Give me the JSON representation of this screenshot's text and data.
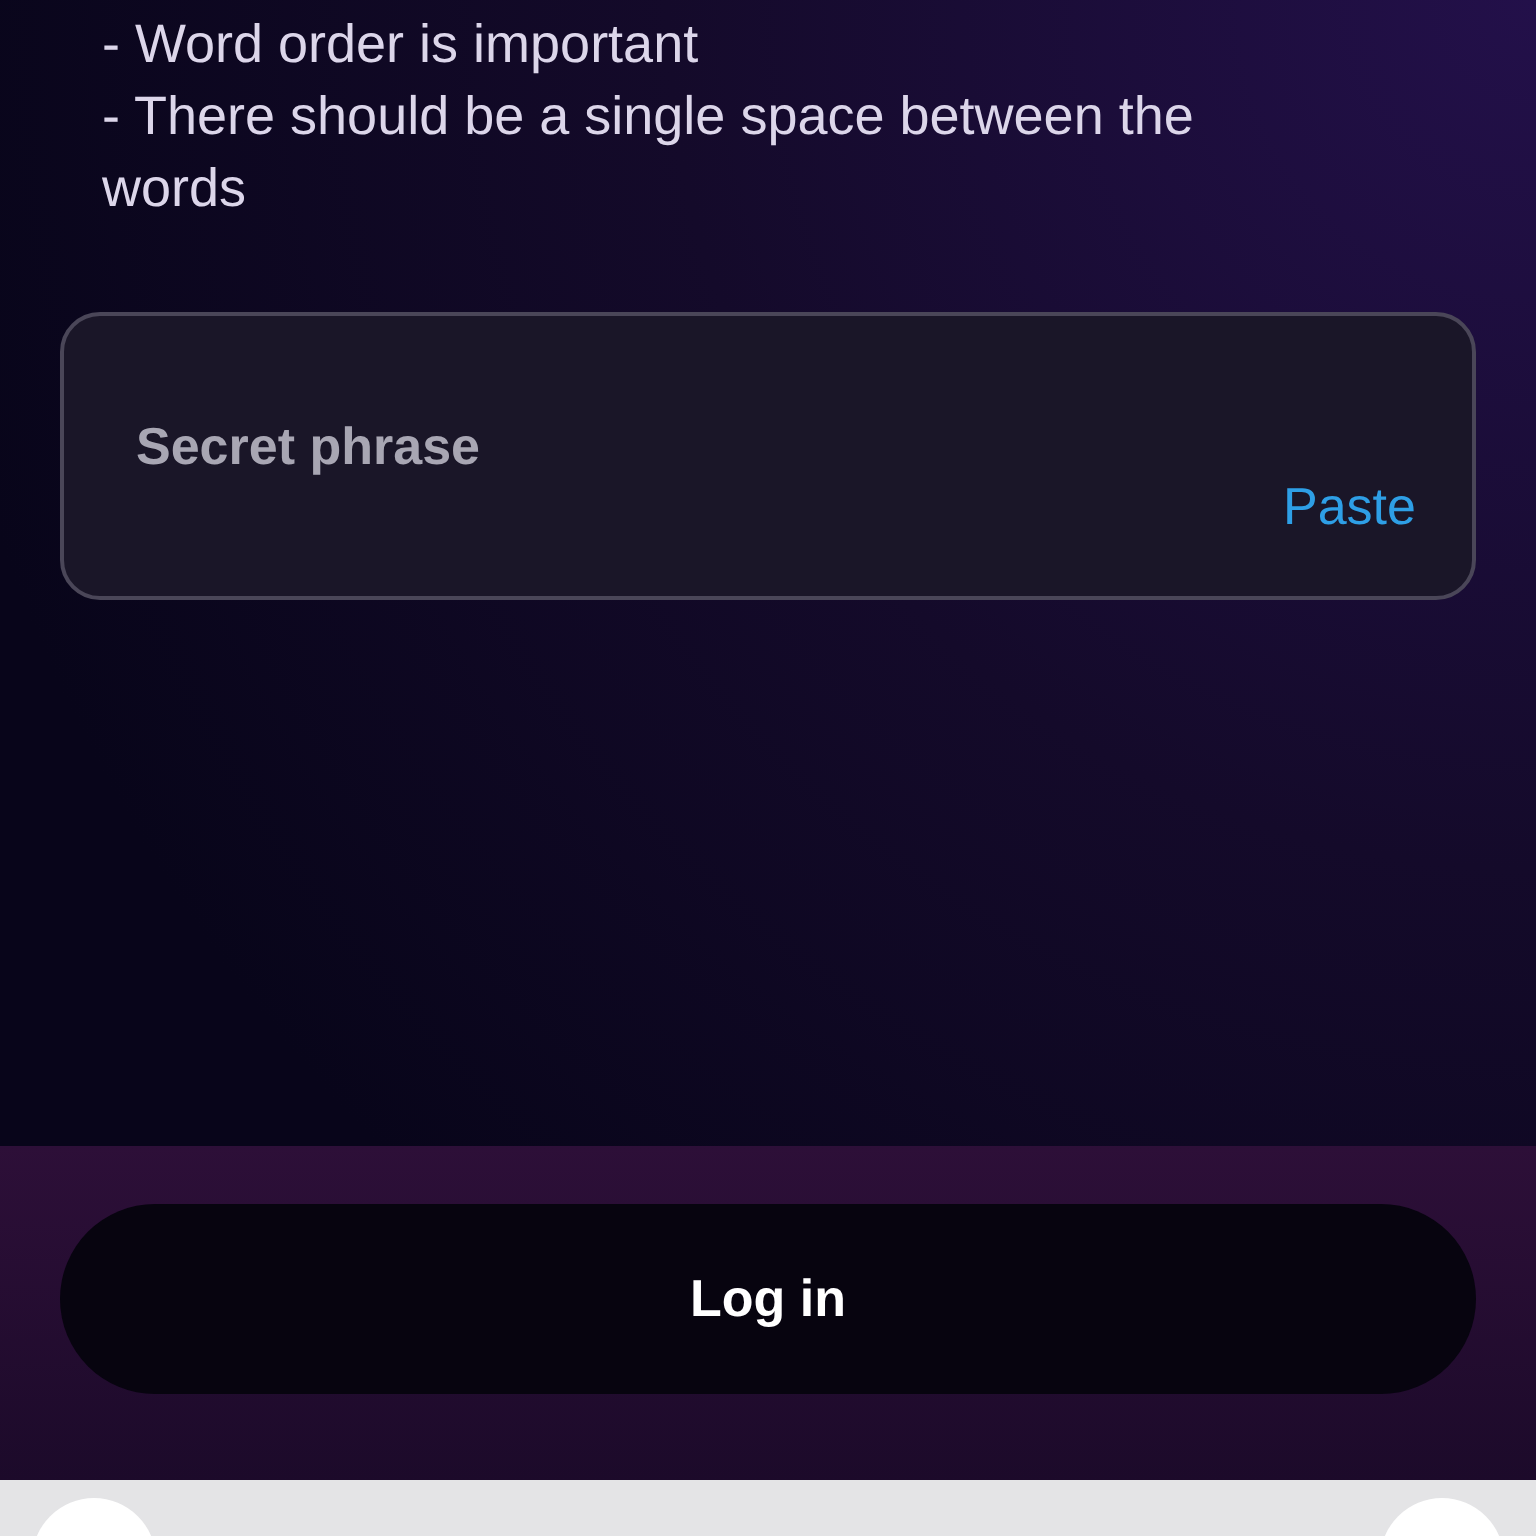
{
  "rules": [
    "- Word order is important",
    "- There should be a single space between the words"
  ],
  "phrase_field": {
    "placeholder": "Secret phrase",
    "action": "Paste"
  },
  "login_button": {
    "label": "Log in"
  }
}
